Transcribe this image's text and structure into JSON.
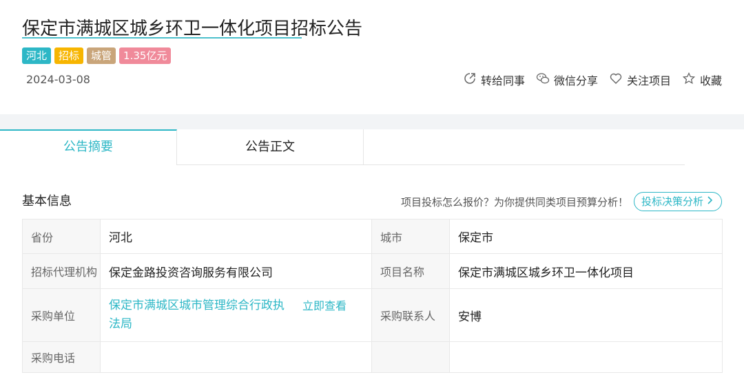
{
  "header": {
    "title": "保定市满城区城乡环卫一体化项目招标公告",
    "tags": [
      "河北",
      "招标",
      "城管",
      "1.35亿元"
    ],
    "date": "2024-03-08",
    "actions": [
      {
        "icon": "forward-icon",
        "label": "转给同事"
      },
      {
        "icon": "wechat-icon",
        "label": "微信分享"
      },
      {
        "icon": "heart-icon",
        "label": "关注项目"
      },
      {
        "icon": "star-icon",
        "label": "收藏"
      }
    ]
  },
  "tabs": [
    {
      "label": "公告摘要",
      "active": true
    },
    {
      "label": "公告正文",
      "active": false
    }
  ],
  "section": {
    "title": "基本信息",
    "promo_text": "项目投标怎么报价？为你提供同类项目预算分析！",
    "promo_button": "投标决策分析"
  },
  "info": {
    "province_label": "省份",
    "province": "河北",
    "city_label": "城市",
    "city": "保定市",
    "agent_label": "招标代理机构",
    "agent": "保定金路投资咨询服务有限公司",
    "project_label": "项目名称",
    "project": "保定市满城区城乡环卫一体化项目",
    "buyer_label": "采购单位",
    "buyer": "保定市满城区城市管理综合行政执法局",
    "buyer_link": "立即查看",
    "contact_label": "采购联系人",
    "contact": "安博",
    "phone_label": "采购电话",
    "phone": ""
  },
  "colors": {
    "accent": "#2db7c6",
    "tag_yellow": "#f7b500",
    "tag_tan": "#c9a57a",
    "tag_pink": "#f08a9a"
  }
}
